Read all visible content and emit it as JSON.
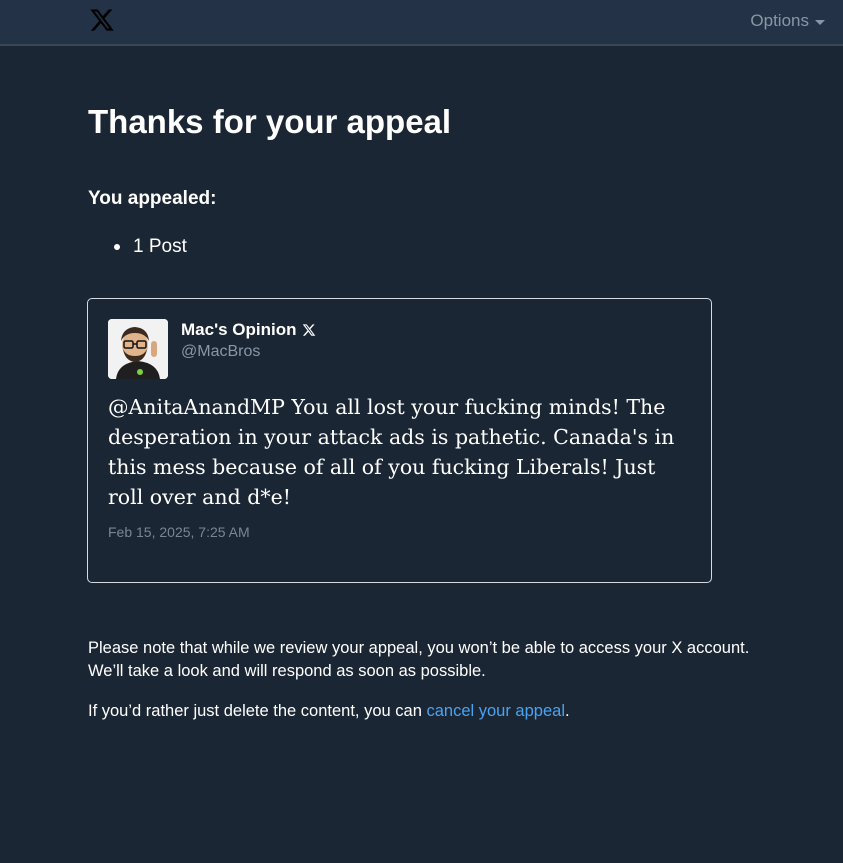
{
  "header": {
    "logo_icon": "x-logo-icon",
    "options_label": "Options"
  },
  "main": {
    "title": "Thanks for your appeal",
    "appealed_label": "You appealed:",
    "appealed_items": [
      "1 Post"
    ]
  },
  "post": {
    "author_name": "Mac's Opinion",
    "author_badge_icon": "x-badge-icon",
    "author_handle": "@MacBros",
    "text": "@AnitaAnandMP You all lost your fucking minds! The desperation in your attack ads is pathetic. Canada's in this mess because of all of you fucking Liberals! Just roll over and d*e!",
    "timestamp": "Feb 15, 2025, 7:25 AM"
  },
  "footer": {
    "note_line1": "Please note that while we review your appeal, you won’t be able to access your X account.",
    "note_line2": "We’ll take a look and will respond as soon as possible.",
    "cancel_prefix": "If you’d rather just delete the content, you can ",
    "cancel_link": "cancel your appeal",
    "cancel_suffix": "."
  },
  "colors": {
    "background": "#1b2635",
    "header_background": "#233246",
    "link": "#4aa3f0",
    "muted_text": "#8a96a5"
  }
}
